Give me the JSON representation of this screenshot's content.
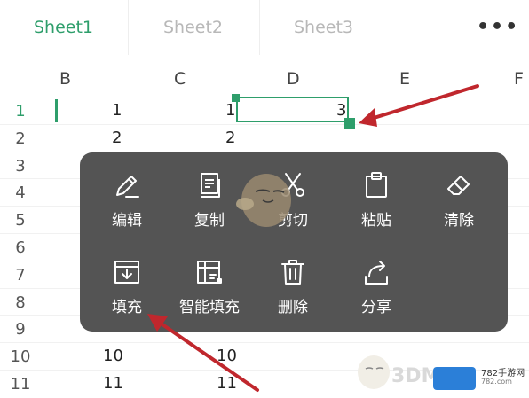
{
  "tabs": {
    "sheet1": "Sheet1",
    "sheet2": "Sheet2",
    "sheet3": "Sheet3",
    "more": "•••"
  },
  "columns": [
    "B",
    "C",
    "D",
    "E",
    "F"
  ],
  "rows": [
    {
      "num": "1",
      "c1": "1",
      "c2": "1",
      "c3": "3"
    },
    {
      "num": "2",
      "c1": "2",
      "c2": "2",
      "c3": ""
    },
    {
      "num": "3",
      "c1": "",
      "c2": "",
      "c3": ""
    },
    {
      "num": "4",
      "c1": "",
      "c2": "",
      "c3": ""
    },
    {
      "num": "5",
      "c1": "",
      "c2": "",
      "c3": ""
    },
    {
      "num": "6",
      "c1": "",
      "c2": "",
      "c3": ""
    },
    {
      "num": "7",
      "c1": "",
      "c2": "",
      "c3": ""
    },
    {
      "num": "8",
      "c1": "",
      "c2": "",
      "c3": ""
    },
    {
      "num": "9",
      "c1": "",
      "c2": "",
      "c3": ""
    },
    {
      "num": "10",
      "c1": "10",
      "c2": "10",
      "c3": ""
    },
    {
      "num": "11",
      "c1": "11",
      "c2": "11",
      "c3": ""
    }
  ],
  "menu": {
    "edit": "编辑",
    "copy": "复制",
    "cut": "剪切",
    "paste": "粘贴",
    "clear": "清除",
    "fill": "填充",
    "smart_fill": "智能填充",
    "delete": "删除",
    "share": "分享"
  },
  "watermark": {
    "brand": "3DM",
    "site": "782手游网",
    "site_url": "782.com"
  },
  "colors": {
    "accent": "#2e9e6b",
    "menu_bg": "#4f4f4f",
    "arrow": "#c0272d"
  },
  "icons": [
    "pencil-icon",
    "copy-icon",
    "scissors-icon",
    "clipboard-icon",
    "eraser-icon",
    "fill-icon",
    "smart-fill-icon",
    "trash-icon",
    "share-icon"
  ]
}
